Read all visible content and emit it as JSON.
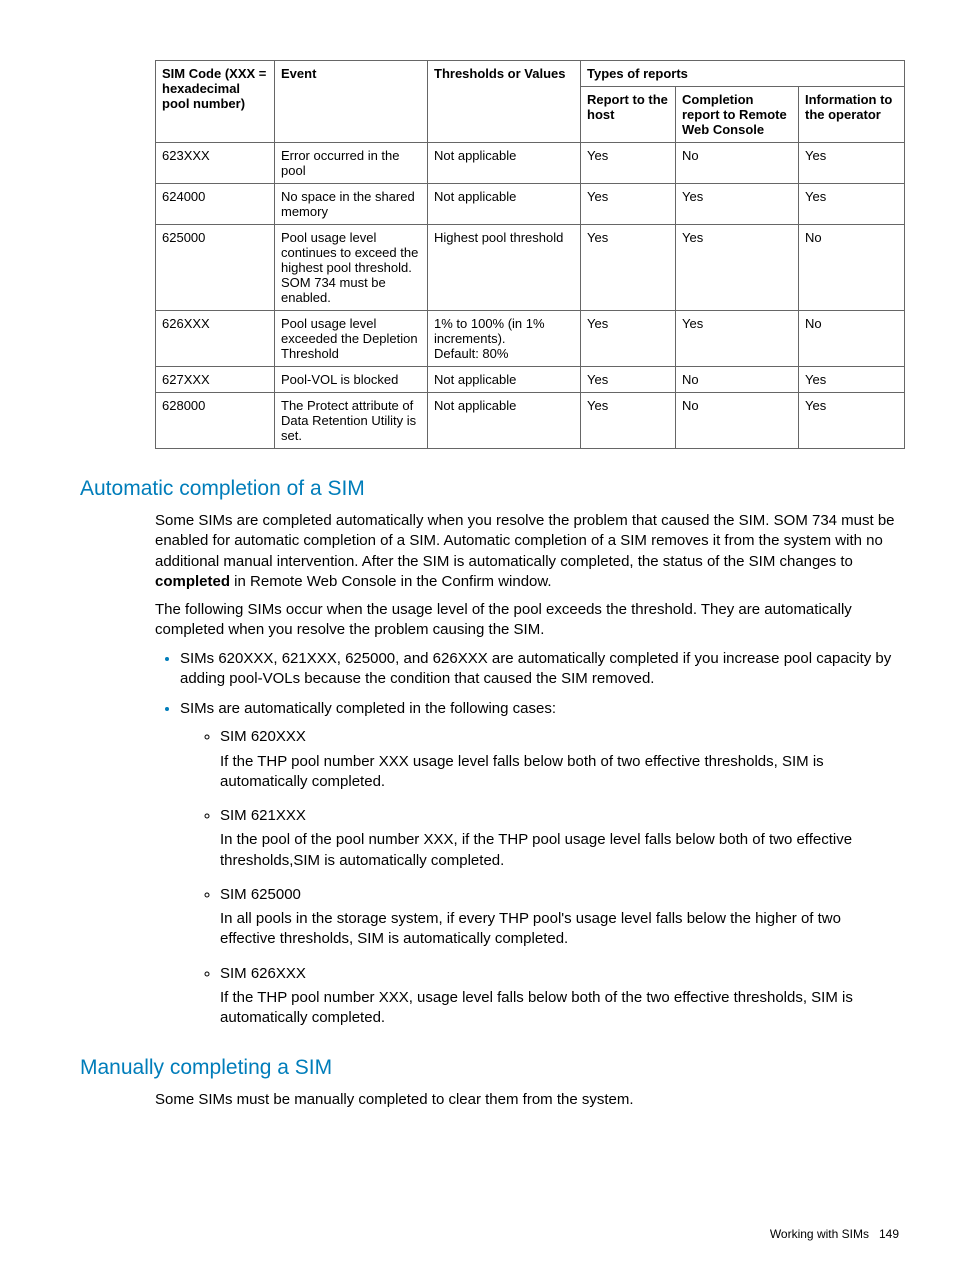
{
  "table": {
    "head": {
      "c1": "SIM Code (XXX = hexadecimal pool number)",
      "c2": "Event",
      "c3": "Thresholds or Values",
      "c4": "Types of reports",
      "c4a": "Report to the host",
      "c4b": "Completion report to Remote Web Console",
      "c4c": "Information to the operator"
    },
    "rows": [
      {
        "code": "623XXX",
        "event": "Error occurred in the pool",
        "thr": "Not applicable",
        "a": "Yes",
        "b": "No",
        "c": "Yes"
      },
      {
        "code": "624000",
        "event": "No space in the shared memory",
        "thr": "Not applicable",
        "a": "Yes",
        "b": "Yes",
        "c": "Yes"
      },
      {
        "code": "625000",
        "event": "Pool usage level continues to exceed the highest pool threshold. SOM 734 must be enabled.",
        "thr": "Highest pool threshold",
        "a": "Yes",
        "b": "Yes",
        "c": "No"
      },
      {
        "code": "626XXX",
        "event": "Pool usage level exceeded the Depletion Threshold",
        "thr": "1% to 100% (in 1% increments).\nDefault: 80%",
        "a": "Yes",
        "b": "Yes",
        "c": "No"
      },
      {
        "code": "627XXX",
        "event": "Pool-VOL is blocked",
        "thr": "Not applicable",
        "a": "Yes",
        "b": "No",
        "c": "Yes"
      },
      {
        "code": "628000",
        "event": "The Protect attribute of Data Retention Utility is set.",
        "thr": "Not applicable",
        "a": "Yes",
        "b": "No",
        "c": "Yes"
      }
    ]
  },
  "section1": {
    "title": "Automatic completion of a SIM",
    "p1a": "Some SIMs are completed automatically when you resolve the problem that caused the SIM. SOM 734 must be enabled for automatic completion of a SIM. Automatic completion of a SIM removes it from the system with no additional manual intervention. After the SIM is automatically completed, the status of the SIM changes to ",
    "p1b": "completed",
    "p1c": " in Remote Web Console in the Confirm window.",
    "p2": "The following SIMs occur when the usage level of the pool exceeds the threshold. They are automatically completed when you resolve the problem causing the SIM.",
    "bullet1": "SIMs 620XXX, 621XXX, 625000, and 626XXX are automatically completed if you increase pool capacity by adding pool-VOLs because the condition that caused the SIM removed.",
    "bullet2": "SIMs are automatically completed in the following cases:",
    "subs": [
      {
        "t": "SIM 620XXX",
        "b": "If the THP pool number XXX usage level falls below both of two effective thresholds, SIM is automatically completed."
      },
      {
        "t": "SIM 621XXX",
        "b": "In the pool of the pool number XXX, if the THP pool usage level falls below both of two effective thresholds,SIM is automatically completed."
      },
      {
        "t": "SIM 625000",
        "b": "In all pools in the storage system, if every THP pool's usage level falls below the higher of two effective thresholds, SIM is automatically completed."
      },
      {
        "t": "SIM 626XXX",
        "b": "If the THP pool number XXX, usage level falls below both of the two effective thresholds, SIM is automatically completed."
      }
    ]
  },
  "section2": {
    "title": "Manually completing a SIM",
    "p1": "Some SIMs must be manually completed to clear them from the system."
  },
  "footer": {
    "text": "Working with SIMs",
    "page": "149"
  }
}
